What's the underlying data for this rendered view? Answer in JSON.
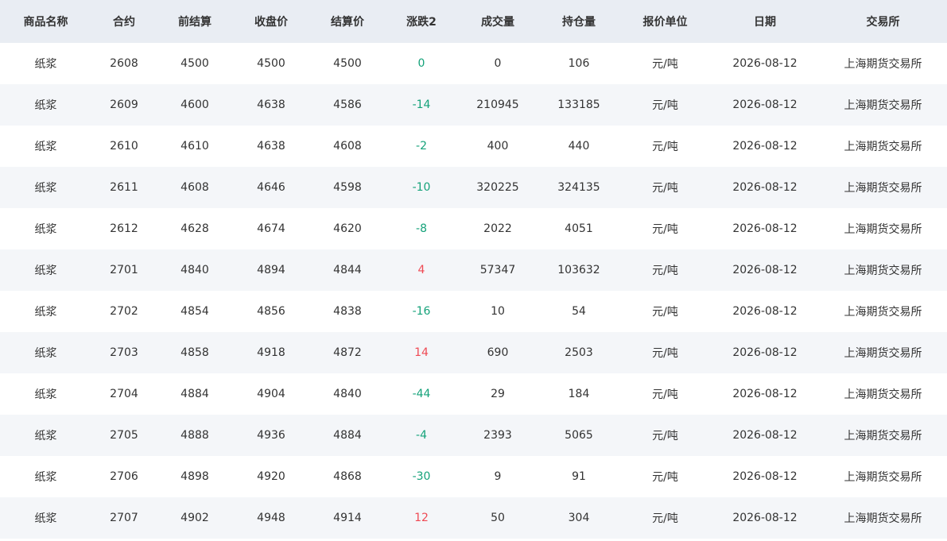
{
  "table": {
    "columns": [
      "商品名称",
      "合约",
      "前结算",
      "收盘价",
      "结算价",
      "涨跌2",
      "成交量",
      "持仓量",
      "报价单位",
      "日期",
      "交易所"
    ],
    "rows": [
      [
        "纸浆",
        "2608",
        "4500",
        "4500",
        "4500",
        "0",
        "0",
        "106",
        "元/吨",
        "2026-08-12",
        "上海期货交易所"
      ],
      [
        "纸浆",
        "2609",
        "4600",
        "4638",
        "4586",
        "-14",
        "210945",
        "133185",
        "元/吨",
        "2026-08-12",
        "上海期货交易所"
      ],
      [
        "纸浆",
        "2610",
        "4610",
        "4638",
        "4608",
        "-2",
        "400",
        "440",
        "元/吨",
        "2026-08-12",
        "上海期货交易所"
      ],
      [
        "纸浆",
        "2611",
        "4608",
        "4646",
        "4598",
        "-10",
        "320225",
        "324135",
        "元/吨",
        "2026-08-12",
        "上海期货交易所"
      ],
      [
        "纸浆",
        "2612",
        "4628",
        "4674",
        "4620",
        "-8",
        "2022",
        "4051",
        "元/吨",
        "2026-08-12",
        "上海期货交易所"
      ],
      [
        "纸浆",
        "2701",
        "4840",
        "4894",
        "4844",
        "4",
        "57347",
        "103632",
        "元/吨",
        "2026-08-12",
        "上海期货交易所"
      ],
      [
        "纸浆",
        "2702",
        "4854",
        "4856",
        "4838",
        "-16",
        "10",
        "54",
        "元/吨",
        "2026-08-12",
        "上海期货交易所"
      ],
      [
        "纸浆",
        "2703",
        "4858",
        "4918",
        "4872",
        "14",
        "690",
        "2503",
        "元/吨",
        "2026-08-12",
        "上海期货交易所"
      ],
      [
        "纸浆",
        "2704",
        "4884",
        "4904",
        "4840",
        "-44",
        "29",
        "184",
        "元/吨",
        "2026-08-12",
        "上海期货交易所"
      ],
      [
        "纸浆",
        "2705",
        "4888",
        "4936",
        "4884",
        "-4",
        "2393",
        "5065",
        "元/吨",
        "2026-08-12",
        "上海期货交易所"
      ],
      [
        "纸浆",
        "2706",
        "4898",
        "4920",
        "4868",
        "-30",
        "9",
        "91",
        "元/吨",
        "2026-08-12",
        "上海期货交易所"
      ],
      [
        "纸浆",
        "2707",
        "4902",
        "4948",
        "4914",
        "12",
        "50",
        "304",
        "元/吨",
        "2026-08-12",
        "上海期货交易所"
      ]
    ]
  },
  "colors": {
    "header_bg": "#e9edf3",
    "stripe_bg": "#f4f6f9",
    "down": "#15a27a",
    "up": "#ef4a54"
  }
}
